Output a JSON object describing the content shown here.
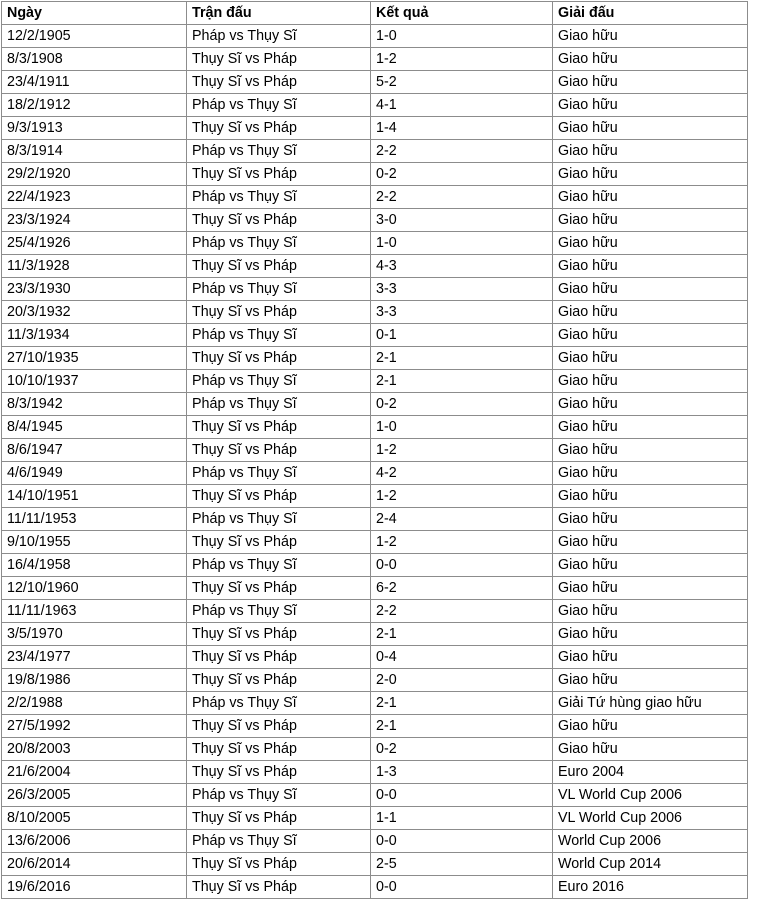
{
  "table": {
    "columns": [
      {
        "key": "date",
        "label": "Ngày"
      },
      {
        "key": "match",
        "label": "Trận đấu"
      },
      {
        "key": "result",
        "label": "Kết quả"
      },
      {
        "key": "comp",
        "label": "Giải đấu"
      }
    ],
    "rows": [
      {
        "date": "12/2/1905",
        "match": "Pháp vs Thụy Sĩ",
        "result": "1-0",
        "comp": "Giao hữu"
      },
      {
        "date": "8/3/1908",
        "match": "Thụy Sĩ vs Pháp",
        "result": "1-2",
        "comp": "Giao hữu"
      },
      {
        "date": "23/4/1911",
        "match": "Thụy Sĩ vs Pháp",
        "result": "5-2",
        "comp": "Giao hữu"
      },
      {
        "date": "18/2/1912",
        "match": "Pháp vs Thụy Sĩ",
        "result": "4-1",
        "comp": "Giao hữu"
      },
      {
        "date": "9/3/1913",
        "match": "Thụy Sĩ vs Pháp",
        "result": "1-4",
        "comp": "Giao hữu"
      },
      {
        "date": "8/3/1914",
        "match": "Pháp vs Thụy Sĩ",
        "result": "2-2",
        "comp": "Giao hữu"
      },
      {
        "date": "29/2/1920",
        "match": "Thụy Sĩ vs Pháp",
        "result": "0-2",
        "comp": "Giao hữu"
      },
      {
        "date": "22/4/1923",
        "match": "Pháp vs Thụy Sĩ",
        "result": "2-2",
        "comp": "Giao hữu"
      },
      {
        "date": "23/3/1924",
        "match": "Thụy Sĩ vs Pháp",
        "result": "3-0",
        "comp": "Giao hữu"
      },
      {
        "date": "25/4/1926",
        "match": "Pháp vs Thụy Sĩ",
        "result": "1-0",
        "comp": "Giao hữu"
      },
      {
        "date": "11/3/1928",
        "match": "Thụy Sĩ vs Pháp",
        "result": "4-3",
        "comp": "Giao hữu"
      },
      {
        "date": "23/3/1930",
        "match": "Pháp vs Thụy Sĩ",
        "result": "3-3",
        "comp": "Giao hữu"
      },
      {
        "date": "20/3/1932",
        "match": "Thụy Sĩ vs Pháp",
        "result": "3-3",
        "comp": "Giao hữu"
      },
      {
        "date": "11/3/1934",
        "match": "Pháp vs Thụy Sĩ",
        "result": "0-1",
        "comp": "Giao hữu"
      },
      {
        "date": "27/10/1935",
        "match": "Thụy Sĩ vs Pháp",
        "result": "2-1",
        "comp": "Giao hữu"
      },
      {
        "date": "10/10/1937",
        "match": "Pháp vs Thụy Sĩ",
        "result": "2-1",
        "comp": "Giao hữu"
      },
      {
        "date": "8/3/1942",
        "match": "Pháp vs Thụy Sĩ",
        "result": "0-2",
        "comp": "Giao hữu"
      },
      {
        "date": "8/4/1945",
        "match": "Thụy Sĩ vs Pháp",
        "result": "1-0",
        "comp": "Giao hữu"
      },
      {
        "date": "8/6/1947",
        "match": "Thụy Sĩ vs Pháp",
        "result": "1-2",
        "comp": "Giao hữu"
      },
      {
        "date": "4/6/1949",
        "match": "Pháp vs Thụy Sĩ",
        "result": "4-2",
        "comp": "Giao hữu"
      },
      {
        "date": "14/10/1951",
        "match": "Thụy Sĩ vs Pháp",
        "result": "1-2",
        "comp": "Giao hữu"
      },
      {
        "date": "11/11/1953",
        "match": "Pháp vs Thụy Sĩ",
        "result": "2-4",
        "comp": "Giao hữu"
      },
      {
        "date": "9/10/1955",
        "match": "Thụy Sĩ vs Pháp",
        "result": "1-2",
        "comp": "Giao hữu"
      },
      {
        "date": "16/4/1958",
        "match": "Pháp vs Thụy Sĩ",
        "result": "0-0",
        "comp": "Giao hữu"
      },
      {
        "date": "12/10/1960",
        "match": "Thụy Sĩ vs Pháp",
        "result": "6-2",
        "comp": "Giao hữu"
      },
      {
        "date": "11/11/1963",
        "match": "Pháp vs Thụy Sĩ",
        "result": "2-2",
        "comp": "Giao hữu"
      },
      {
        "date": "3/5/1970",
        "match": "Thụy Sĩ vs Pháp",
        "result": "2-1",
        "comp": "Giao hữu"
      },
      {
        "date": "23/4/1977",
        "match": "Thụy Sĩ vs Pháp",
        "result": "0-4",
        "comp": "Giao hữu"
      },
      {
        "date": "19/8/1986",
        "match": "Thụy Sĩ vs Pháp",
        "result": "2-0",
        "comp": "Giao hữu"
      },
      {
        "date": "2/2/1988",
        "match": "Pháp vs Thụy Sĩ",
        "result": "2-1",
        "comp": "Giải Tứ hùng giao hữu"
      },
      {
        "date": "27/5/1992",
        "match": "Thụy Sĩ vs Pháp",
        "result": "2-1",
        "comp": "Giao hữu"
      },
      {
        "date": "20/8/2003",
        "match": "Thụy Sĩ vs Pháp",
        "result": "0-2",
        "comp": "Giao hữu"
      },
      {
        "date": "21/6/2004",
        "match": "Thụy Sĩ vs Pháp",
        "result": "1-3",
        "comp": "Euro 2004"
      },
      {
        "date": "26/3/2005",
        "match": "Pháp vs Thụy Sĩ",
        "result": "0-0",
        "comp": "VL World Cup 2006"
      },
      {
        "date": "8/10/2005",
        "match": "Thụy Sĩ vs Pháp",
        "result": "1-1",
        "comp": "VL World Cup 2006"
      },
      {
        "date": "13/6/2006",
        "match": "Pháp vs Thụy Sĩ",
        "result": "0-0",
        "comp": "World Cup 2006"
      },
      {
        "date": "20/6/2014",
        "match": "Thụy Sĩ vs Pháp",
        "result": "2-5",
        "comp": "World Cup 2014"
      },
      {
        "date": "19/6/2016",
        "match": "Thụy Sĩ vs Pháp",
        "result": "0-0",
        "comp": "Euro 2016"
      }
    ]
  },
  "colors": {
    "border": "#8c8c8c",
    "text": "#000000",
    "background": "#ffffff"
  }
}
